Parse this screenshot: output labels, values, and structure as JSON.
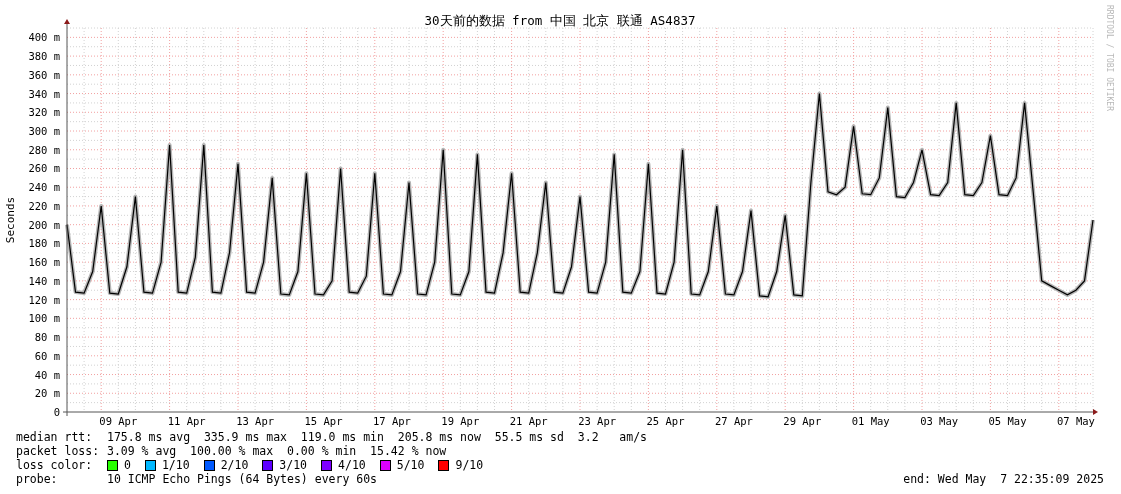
{
  "chart": {
    "vendor_text": "RRDTOOL / TOBI OETIKER",
    "chart_data": {
      "type": "line",
      "title": "30天前的数据 from 中国 北京 联通 AS4837",
      "ylabel": "Seconds",
      "categories": [
        null,
        null,
        null,
        null,
        null,
        null,
        "09 Apr",
        null,
        null,
        null,
        null,
        null,
        null,
        null,
        "11 Apr",
        null,
        null,
        null,
        null,
        null,
        null,
        null,
        "13 Apr",
        null,
        null,
        null,
        null,
        null,
        null,
        null,
        "15 Apr",
        null,
        null,
        null,
        null,
        null,
        null,
        null,
        "17 Apr",
        null,
        null,
        null,
        null,
        null,
        null,
        null,
        "19 Apr",
        null,
        null,
        null,
        null,
        null,
        null,
        null,
        "21 Apr",
        null,
        null,
        null,
        null,
        null,
        null,
        null,
        "23 Apr",
        null,
        null,
        null,
        null,
        null,
        null,
        null,
        "25 Apr",
        null,
        null,
        null,
        null,
        null,
        null,
        null,
        "27 Apr",
        null,
        null,
        null,
        null,
        null,
        null,
        null,
        "29 Apr",
        null,
        null,
        null,
        null,
        null,
        null,
        null,
        "01 May",
        null,
        null,
        null,
        null,
        null,
        null,
        null,
        "03 May",
        null,
        null,
        null,
        null,
        null,
        null,
        null,
        "05 May",
        null,
        null,
        null,
        null,
        null,
        null,
        null,
        "07 May",
        null,
        null
      ],
      "series": [
        {
          "color": "#000000",
          "values": [
            200,
            128,
            127,
            150,
            220,
            127,
            126,
            155,
            230,
            128,
            127,
            160,
            285,
            128,
            127,
            165,
            285,
            128,
            127,
            170,
            265,
            128,
            127,
            160,
            250,
            126,
            125,
            150,
            255,
            126,
            125,
            140,
            260,
            128,
            127,
            145,
            255,
            126,
            125,
            150,
            245,
            126,
            125,
            160,
            280,
            126,
            125,
            150,
            275,
            128,
            127,
            170,
            255,
            128,
            127,
            170,
            245,
            128,
            127,
            155,
            230,
            128,
            127,
            160,
            275,
            128,
            127,
            150,
            265,
            127,
            126,
            160,
            280,
            126,
            125,
            150,
            220,
            126,
            125,
            150,
            215,
            124,
            123,
            150,
            210,
            125,
            124,
            245,
            340,
            235,
            232,
            240,
            305,
            233,
            232,
            250,
            325,
            230,
            229,
            245,
            280,
            232,
            231,
            245,
            330,
            232,
            231,
            245,
            295,
            232,
            231,
            250,
            330,
            235,
            140,
            135,
            130,
            125,
            130,
            140,
            205
          ]
        }
      ],
      "ylim": [
        0,
        410
      ],
      "grid": true,
      "yticks": [
        {
          "value": 0,
          "label": "0"
        },
        {
          "value": 20,
          "label": "20 m"
        },
        {
          "value": 40,
          "label": "40 m"
        },
        {
          "value": 60,
          "label": "60 m"
        },
        {
          "value": 80,
          "label": "80 m"
        },
        {
          "value": 100,
          "label": "100 m"
        },
        {
          "value": 120,
          "label": "120 m"
        },
        {
          "value": 140,
          "label": "140 m"
        },
        {
          "value": 160,
          "label": "160 m"
        },
        {
          "value": 180,
          "label": "180 m"
        },
        {
          "value": 200,
          "label": "200 m"
        },
        {
          "value": 220,
          "label": "220 m"
        },
        {
          "value": 240,
          "label": "240 m"
        },
        {
          "value": 260,
          "label": "260 m"
        },
        {
          "value": 280,
          "label": "280 m"
        },
        {
          "value": 300,
          "label": "300 m"
        },
        {
          "value": 320,
          "label": "320 m"
        },
        {
          "value": 340,
          "label": "340 m"
        },
        {
          "value": 360,
          "label": "360 m"
        },
        {
          "value": 380,
          "label": "380 m"
        },
        {
          "value": 400,
          "label": "400 m"
        }
      ]
    }
  },
  "legend": {
    "rows": [
      {
        "label": "median rtt:",
        "text": "175.8 ms avg  335.9 ms max  119.0 ms min  205.8 ms now  55.5 ms sd  3.2   am/s"
      },
      {
        "label": "packet loss:",
        "text": "3.09 % avg  100.00 % max  0.00 % min  15.42 % now"
      }
    ],
    "loss_color": {
      "label": "loss color:",
      "items": [
        {
          "label": "0",
          "color": "#26ff00"
        },
        {
          "label": "1/10",
          "color": "#00b8ff"
        },
        {
          "label": "2/10",
          "color": "#0059ff"
        },
        {
          "label": "3/10",
          "color": "#5e00ff"
        },
        {
          "label": "4/10",
          "color": "#7e00ff"
        },
        {
          "label": "5/10",
          "color": "#dd00ff"
        },
        {
          "label": "9/10",
          "color": "#ff0000"
        }
      ]
    },
    "probe": {
      "label": "probe:",
      "text": "10 ICMP Echo Pings (64 Bytes) every 60s"
    },
    "end": "end: Wed May  7 22:35:09 2025"
  }
}
